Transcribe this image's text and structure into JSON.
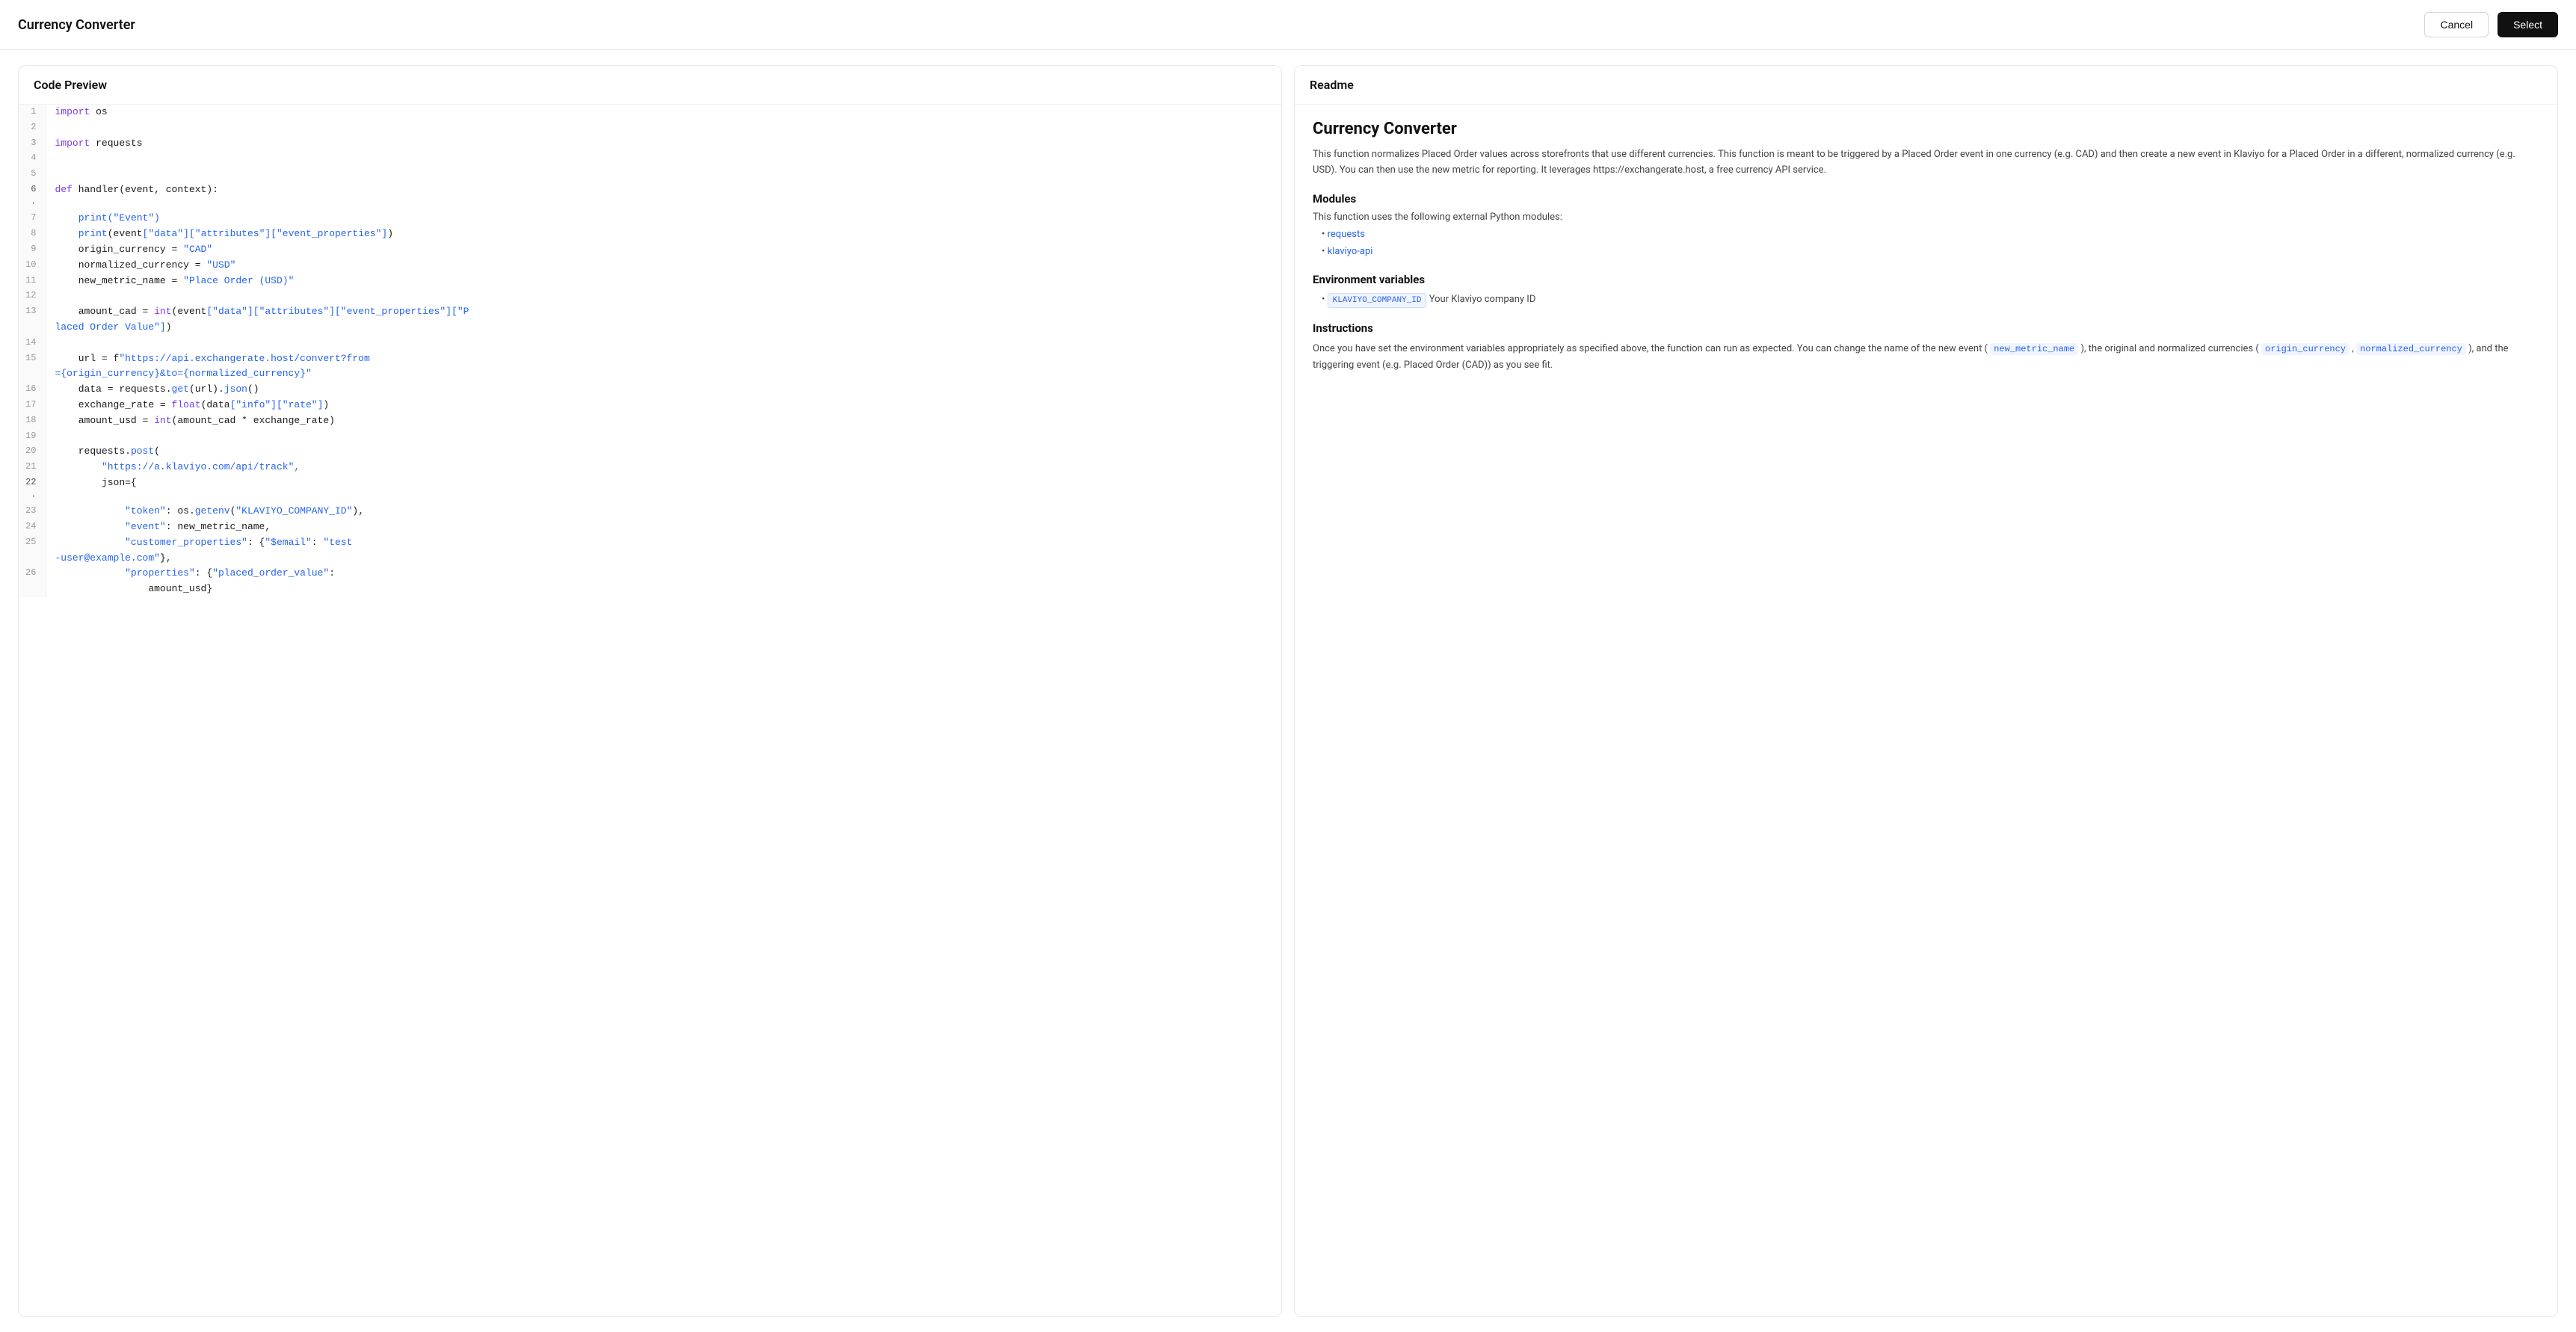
{
  "header": {
    "title": "Currency Converter",
    "cancel_label": "Cancel",
    "select_label": "Select"
  },
  "code_preview": {
    "panel_title": "Code Preview",
    "lines": [
      {
        "num": 1,
        "active": false,
        "content": [
          {
            "type": "kw",
            "text": "import"
          },
          {
            "type": "plain",
            "text": " os"
          }
        ]
      },
      {
        "num": 2,
        "active": false,
        "content": []
      },
      {
        "num": 3,
        "active": false,
        "content": [
          {
            "type": "kw",
            "text": "import"
          },
          {
            "type": "plain",
            "text": " requests"
          }
        ]
      },
      {
        "num": 4,
        "active": false,
        "content": []
      },
      {
        "num": 5,
        "active": false,
        "content": []
      },
      {
        "num": 6,
        "active": true,
        "content": [
          {
            "type": "kw",
            "text": "def"
          },
          {
            "type": "plain",
            "text": " handler(event, context):"
          }
        ]
      },
      {
        "num": 7,
        "active": false,
        "content": [
          {
            "type": "plain",
            "text": "    "
          },
          {
            "type": "fn",
            "text": "print"
          },
          {
            "type": "str",
            "text": "(\"Event\")"
          }
        ]
      },
      {
        "num": 8,
        "active": false,
        "content": [
          {
            "type": "plain",
            "text": "    "
          },
          {
            "type": "fn",
            "text": "print"
          },
          {
            "type": "plain",
            "text": "(event"
          },
          {
            "type": "str",
            "text": "[\"data\"]"
          },
          {
            "type": "str",
            "text": "[\"attributes\"]"
          },
          {
            "type": "str",
            "text": "[\"event_properties\"]"
          },
          {
            "type": "plain",
            "text": "])"
          }
        ]
      },
      {
        "num": 9,
        "active": false,
        "content": [
          {
            "type": "plain",
            "text": "    origin_currency = "
          },
          {
            "type": "str",
            "text": "\"CAD\""
          }
        ]
      },
      {
        "num": 10,
        "active": false,
        "content": [
          {
            "type": "plain",
            "text": "    normalized_currency = "
          },
          {
            "type": "str",
            "text": "\"USD\""
          }
        ]
      },
      {
        "num": 11,
        "active": false,
        "content": [
          {
            "type": "plain",
            "text": "    new_metric_name = "
          },
          {
            "type": "str",
            "text": "\"Place Order (USD)\""
          }
        ]
      },
      {
        "num": 12,
        "active": false,
        "content": []
      },
      {
        "num": 13,
        "active": false,
        "content": [
          {
            "type": "plain",
            "text": "    amount_cad = "
          },
          {
            "type": "kw",
            "text": "int"
          },
          {
            "type": "plain",
            "text": "(event"
          },
          {
            "type": "str",
            "text": "[\"data\"]"
          },
          {
            "type": "str",
            "text": "[\"attributes\"]"
          },
          {
            "type": "str",
            "text": "[\"event_properties\"]"
          },
          {
            "type": "str",
            "text": "[\"P"
          }
        ]
      },
      {
        "num": "",
        "active": false,
        "content": [
          {
            "type": "str",
            "text": "laced Order Value\"]"
          },
          {
            "type": "plain",
            "text": ")"
          }
        ]
      },
      {
        "num": 14,
        "active": false,
        "content": []
      },
      {
        "num": 15,
        "active": false,
        "content": [
          {
            "type": "plain",
            "text": "    url = f"
          },
          {
            "type": "str",
            "text": "\"https://api.exchangerate.host/convert?from={origin_currency}&to={normalized_currency}\""
          }
        ]
      },
      {
        "num": 16,
        "active": false,
        "content": [
          {
            "type": "plain",
            "text": "    data = requests."
          },
          {
            "type": "fn",
            "text": "get"
          },
          {
            "type": "plain",
            "text": "(url)."
          },
          {
            "type": "fn",
            "text": "json"
          },
          {
            "type": "plain",
            "text": "()"
          }
        ]
      },
      {
        "num": 17,
        "active": false,
        "content": [
          {
            "type": "plain",
            "text": "    exchange_rate = "
          },
          {
            "type": "kw",
            "text": "float"
          },
          {
            "type": "plain",
            "text": "(data"
          },
          {
            "type": "str",
            "text": "[\"info\"]"
          },
          {
            "type": "str",
            "text": "[\"rate\"]"
          },
          {
            "type": "plain",
            "text": ")"
          }
        ]
      },
      {
        "num": 18,
        "active": false,
        "content": [
          {
            "type": "plain",
            "text": "    amount_usd = "
          },
          {
            "type": "kw",
            "text": "int"
          },
          {
            "type": "plain",
            "text": "(amount_cad * exchange_rate)"
          }
        ]
      },
      {
        "num": 19,
        "active": false,
        "content": []
      },
      {
        "num": 20,
        "active": false,
        "content": [
          {
            "type": "plain",
            "text": "    requests."
          },
          {
            "type": "fn",
            "text": "post"
          },
          {
            "type": "plain",
            "text": "("
          }
        ]
      },
      {
        "num": 21,
        "active": false,
        "content": [
          {
            "type": "str",
            "text": "        \"https://a.klaviyo.com/api/track\","
          }
        ]
      },
      {
        "num": 22,
        "active": true,
        "content": [
          {
            "type": "plain",
            "text": "        json={"
          }
        ]
      },
      {
        "num": 23,
        "active": false,
        "content": [
          {
            "type": "str",
            "text": "            \"token\""
          },
          {
            "type": "plain",
            "text": ": os."
          },
          {
            "type": "fn",
            "text": "getenv"
          },
          {
            "type": "plain",
            "text": "("
          },
          {
            "type": "str",
            "text": "\"KLAVIYO_COMPANY_ID\""
          },
          {
            "type": "plain",
            "text": "),"
          }
        ]
      },
      {
        "num": 24,
        "active": false,
        "content": [
          {
            "type": "str",
            "text": "            \"event\""
          },
          {
            "type": "plain",
            "text": ": new_metric_name,"
          }
        ]
      },
      {
        "num": 25,
        "active": false,
        "content": [
          {
            "type": "str",
            "text": "            \"customer_properties\""
          },
          {
            "type": "plain",
            "text": ": {"
          },
          {
            "type": "str",
            "text": "\"$email\""
          },
          {
            "type": "plain",
            "text": ": "
          },
          {
            "type": "str",
            "text": "\"test"
          }
        ]
      },
      {
        "num": "",
        "active": false,
        "content": [
          {
            "type": "str",
            "text": "-user@example.com\""
          },
          {
            "type": "plain",
            "text": "},"
          }
        ]
      },
      {
        "num": 26,
        "active": false,
        "content": [
          {
            "type": "str",
            "text": "            \"properties\""
          },
          {
            "type": "plain",
            "text": ": {"
          },
          {
            "type": "str",
            "text": "\"placed_order_value\""
          },
          {
            "type": "plain",
            "text": ":"
          }
        ]
      },
      {
        "num": "",
        "active": false,
        "content": [
          {
            "type": "plain",
            "text": "                amount_usd}"
          }
        ]
      }
    ]
  },
  "readme": {
    "panel_title": "Readme",
    "title": "Currency Converter",
    "description": "This function normalizes Placed Order values across storefronts that use different currencies. This function is meant to be triggered by a Placed Order event in one currency (e.g. CAD) and then create a new event in Klaviyo for a Placed Order in a different, normalized currency (e.g. USD). You can then use the new metric for reporting. It leverages https://exchangerate.host, a free currency API service.",
    "modules_title": "Modules",
    "modules_desc": "This function uses the following external Python modules:",
    "modules": [
      "requests",
      "klaviyo-api"
    ],
    "env_title": "Environment variables",
    "env_vars": [
      {
        "name": "KLAVIYO_COMPANY_ID",
        "desc": " Your Klaviyo company ID"
      }
    ],
    "instructions_title": "Instructions",
    "instructions": "Once you have set the environment variables appropriately as specified above, the function can run as expected. You can change the name of the new event ( new_metric_name ), the original and normalized currencies ( origin_currency ,  normalized_currency ), and the triggering event (e.g. Placed Order (CAD)) as you see fit."
  }
}
